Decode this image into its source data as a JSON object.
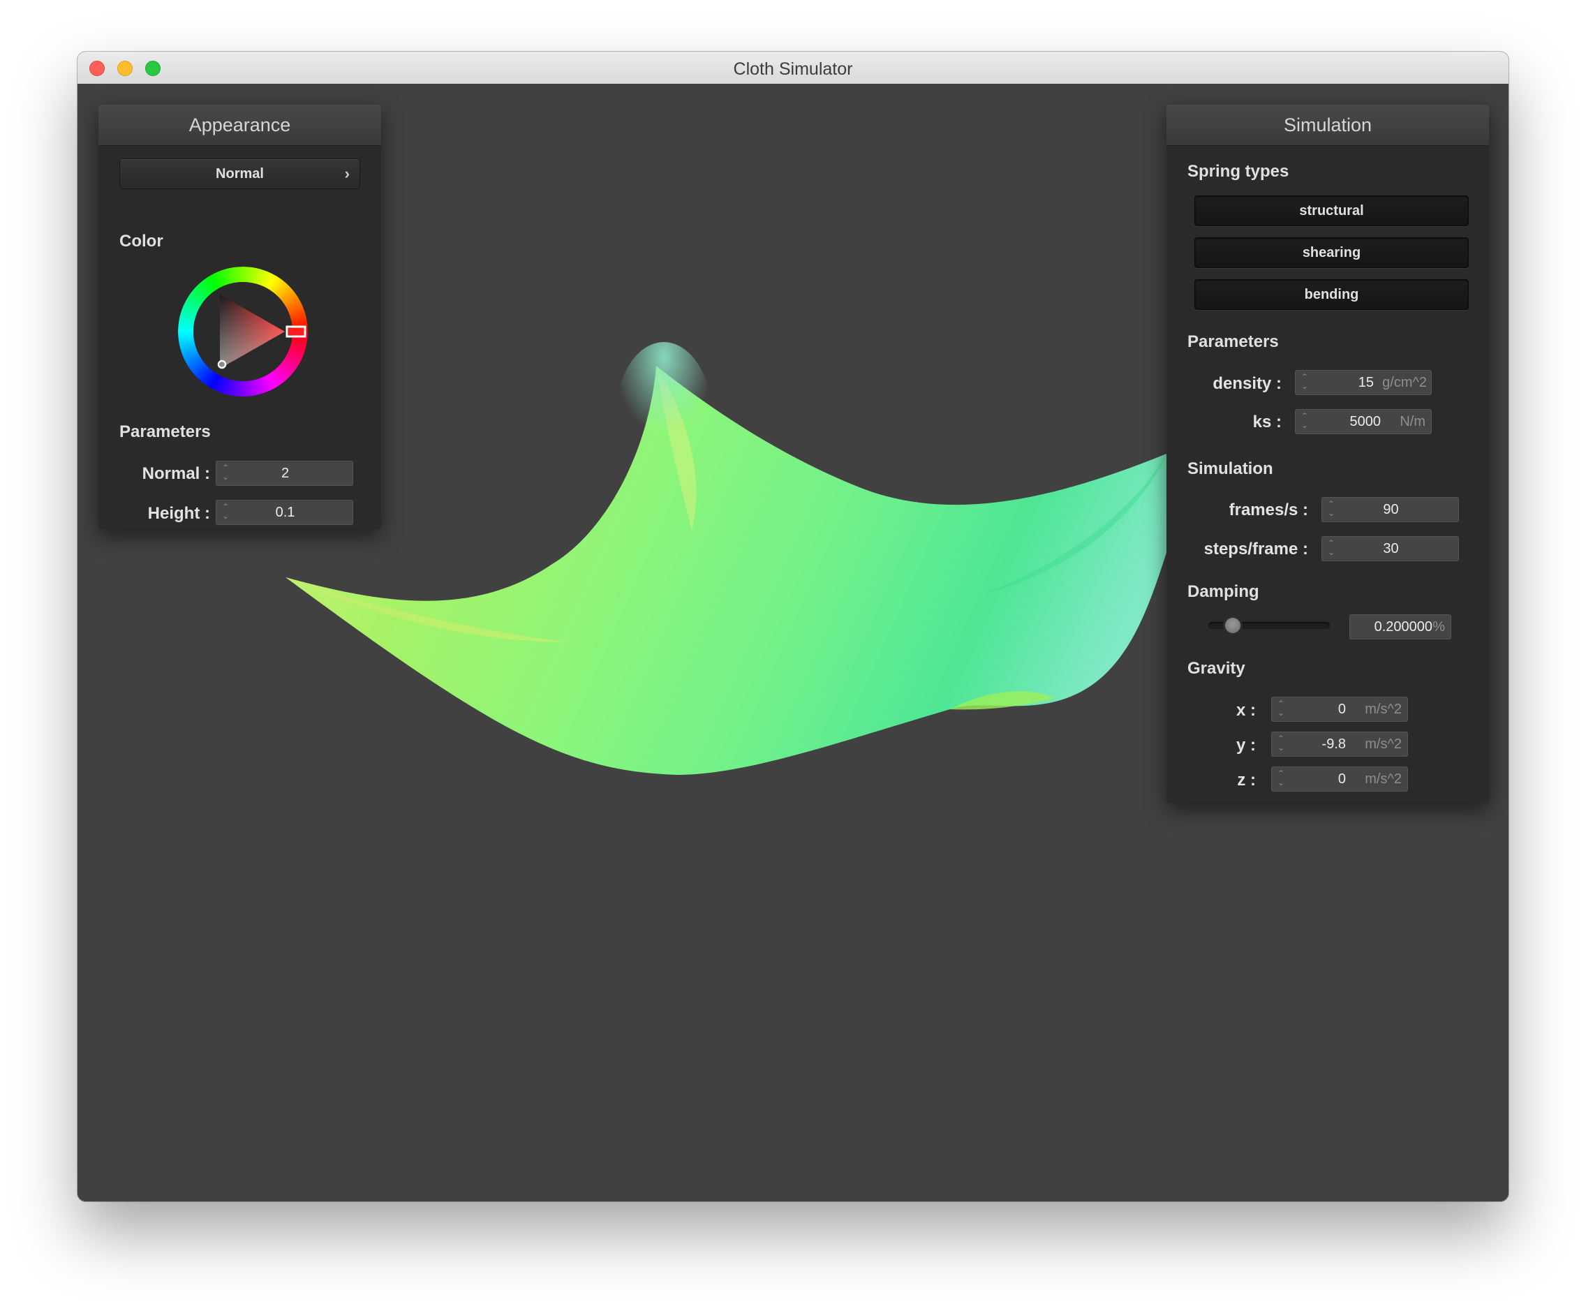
{
  "window": {
    "title": "Cloth Simulator"
  },
  "appearance": {
    "header": "Appearance",
    "shader_select": {
      "value": "Normal",
      "chevron": "›"
    },
    "color_label": "Color",
    "selected_color": "#ff1e1e",
    "params_label": "Parameters",
    "normal": {
      "label": "Normal :",
      "value": "2"
    },
    "height": {
      "label": "Height :",
      "value": "0.1"
    }
  },
  "simulation": {
    "header": "Simulation",
    "spring_types_label": "Spring types",
    "springs": [
      "structural",
      "shearing",
      "bending"
    ],
    "params_label": "Parameters",
    "density": {
      "label": "density :",
      "value": "15",
      "unit": "g/cm^2"
    },
    "ks": {
      "label": "ks :",
      "value": "5000",
      "unit": "N/m"
    },
    "sim_label": "Simulation",
    "fps": {
      "label": "frames/s :",
      "value": "90"
    },
    "steps": {
      "label": "steps/frame :",
      "value": "30"
    },
    "damping_label": "Damping",
    "damping": {
      "fraction": 0.2,
      "value": "0.200000",
      "unit": "%"
    },
    "gravity_label": "Gravity",
    "gx": {
      "label": "x :",
      "value": "0",
      "unit": "m/s^2"
    },
    "gy": {
      "label": "y :",
      "value": "-9.8",
      "unit": "m/s^2"
    },
    "gz": {
      "label": "z :",
      "value": "0",
      "unit": "m/s^2"
    }
  },
  "icons": {
    "spinner": "up-down-arrows",
    "dropdown": "chevron-right"
  }
}
